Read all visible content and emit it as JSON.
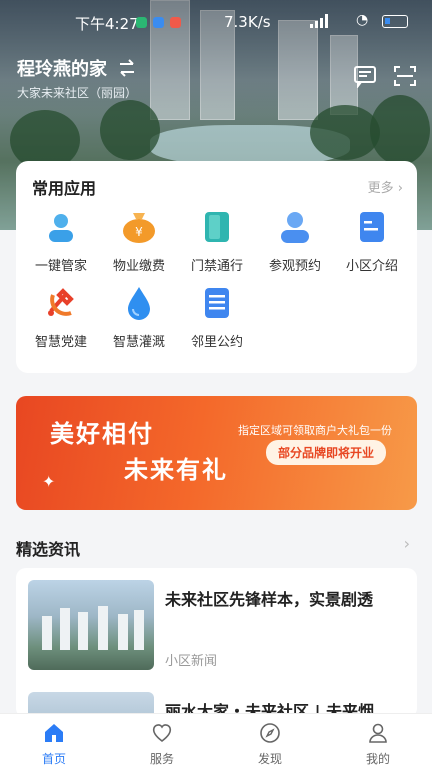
{
  "status_bar": {
    "time": "下午4:27",
    "network_speed": "7.3K/s"
  },
  "header": {
    "home_name": "程玲燕的家",
    "community": "大家未来社区（丽园）"
  },
  "apps": {
    "title": "常用应用",
    "more": "更多",
    "items": [
      {
        "label": "一键管家",
        "icon": "butler-icon",
        "color": "#3aa0e8"
      },
      {
        "label": "物业缴费",
        "icon": "payment-icon",
        "color": "#f39a2a"
      },
      {
        "label": "门禁通行",
        "icon": "door-access-icon",
        "color": "#2fb5b0"
      },
      {
        "label": "参观预约",
        "icon": "visit-reservation-icon",
        "color": "#4a8ff0"
      },
      {
        "label": "小区介绍",
        "icon": "community-intro-icon",
        "color": "#3f86ef"
      },
      {
        "label": "智慧党建",
        "icon": "party-building-icon",
        "color": "#e8402a"
      },
      {
        "label": "智慧灌溉",
        "icon": "irrigation-icon",
        "color": "#2f8ff0"
      },
      {
        "label": "邻里公约",
        "icon": "neighbor-convention-icon",
        "color": "#3f86ef"
      }
    ]
  },
  "banner": {
    "line1": "美好相付",
    "line2": "未来有礼",
    "right_line1": "指定区域可领取商户大礼包一份",
    "right_line2": "部分品牌即将开业"
  },
  "news": {
    "title": "精选资讯",
    "items": [
      {
        "title": "未来社区先锋样本，实景剧透",
        "source": "小区新闻"
      },
      {
        "title": "丽水大家・未来社区 | 未来烟"
      }
    ]
  },
  "tabbar": {
    "items": [
      {
        "label": "首页",
        "icon": "home-icon"
      },
      {
        "label": "服务",
        "icon": "heart-icon"
      },
      {
        "label": "发现",
        "icon": "compass-icon"
      },
      {
        "label": "我的",
        "icon": "profile-icon"
      }
    ]
  }
}
